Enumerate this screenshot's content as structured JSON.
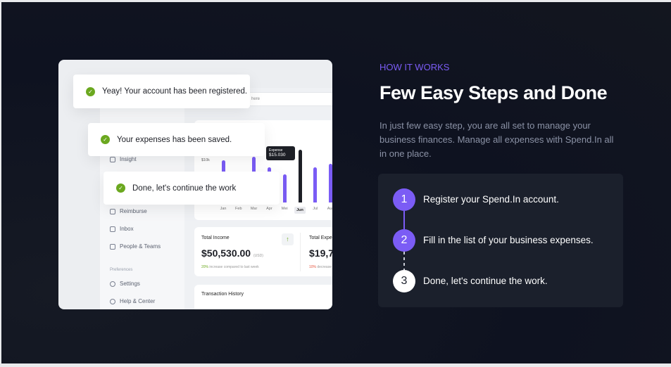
{
  "toasts": [
    "Yeay! Your account has been registered.",
    "Your expenses has been saved.",
    "Done, let's continue the work"
  ],
  "mockup": {
    "search_placeholder": "here",
    "sidebar": {
      "items": [
        "Insight",
        "Reimburse",
        "Inbox",
        "People & Teams"
      ],
      "section": "Preferences",
      "pref_items": [
        "Settings",
        "Help & Center"
      ]
    },
    "chart": {
      "y_tick": "$10k",
      "months": [
        "Jan",
        "Feb",
        "Mar",
        "Apr",
        "Mei",
        "Jun",
        "Jul",
        "Aug"
      ],
      "values": [
        12,
        0,
        13,
        10,
        8,
        15.03,
        10,
        11
      ],
      "active": "Jun",
      "tooltip_label": "Expense",
      "tooltip_value": "$15.030",
      "bar_color": "#7a5cf5"
    },
    "income": {
      "label": "Total Income",
      "amount": "$50,530.00",
      "currency": "(USD)",
      "pct": "20%",
      "note": "increase compared to last week"
    },
    "expense": {
      "label": "Total Expe",
      "amount": "$19,7",
      "pct": "10%",
      "note": "decrease"
    },
    "transactions": {
      "label": "Transaction History"
    }
  },
  "section": {
    "eyebrow": "HOW IT WORKS",
    "title": "Few Easy Steps and Done",
    "description": "In just few easy step, you are all set to manage your business finances. Manage all expenses with Spend.In all in one place."
  },
  "steps": [
    {
      "num": "1",
      "text": "Register your Spend.In account."
    },
    {
      "num": "2",
      "text": "Fill in the list of your business expenses."
    },
    {
      "num": "3",
      "text": "Done, let's continue the work."
    }
  ],
  "colors": {
    "accent": "#7b5cf5",
    "success": "#6ba81f"
  }
}
